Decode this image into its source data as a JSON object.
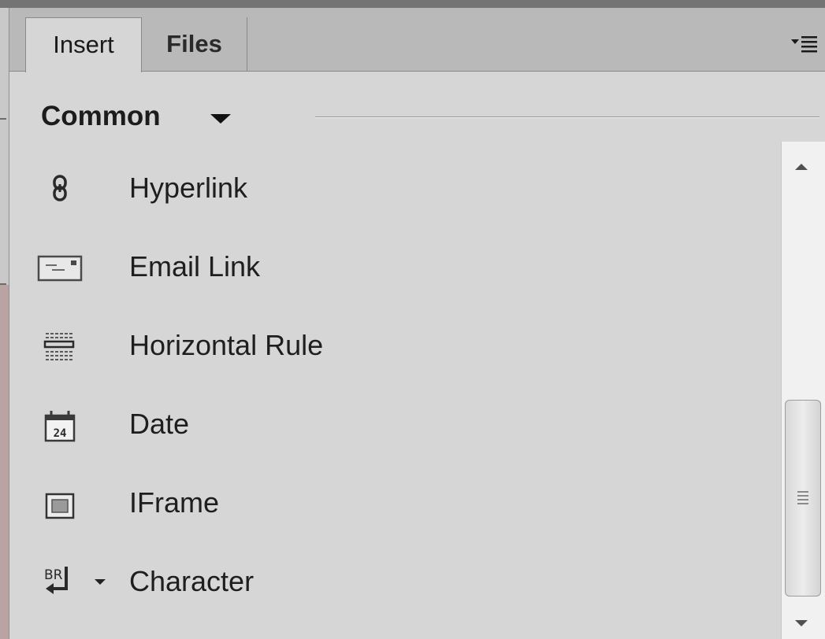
{
  "tabs": [
    {
      "label": "Insert",
      "active": true
    },
    {
      "label": "Files",
      "active": false
    }
  ],
  "panel_menu_icon": "panel-options-menu-icon",
  "category": {
    "label": "Common",
    "arrow_icon": "dropdown-arrow-icon"
  },
  "items": [
    {
      "label": "Hyperlink",
      "icon": "hyperlink-icon"
    },
    {
      "label": "Email Link",
      "icon": "email-link-icon"
    },
    {
      "label": "Horizontal Rule",
      "icon": "horizontal-rule-icon"
    },
    {
      "label": "Date",
      "icon": "calendar-date-icon",
      "icon_text": "24"
    },
    {
      "label": "IFrame",
      "icon": "iframe-icon"
    },
    {
      "label": "Character",
      "icon": "line-break-character-icon",
      "icon_text": "BR",
      "has_dropdown": true
    }
  ],
  "colors": {
    "panel_bg": "#d6d6d6",
    "tabbar_bg": "#b9b9b9",
    "text": "#1e1e1e",
    "scrollbar_bg": "#f1f1f1"
  }
}
